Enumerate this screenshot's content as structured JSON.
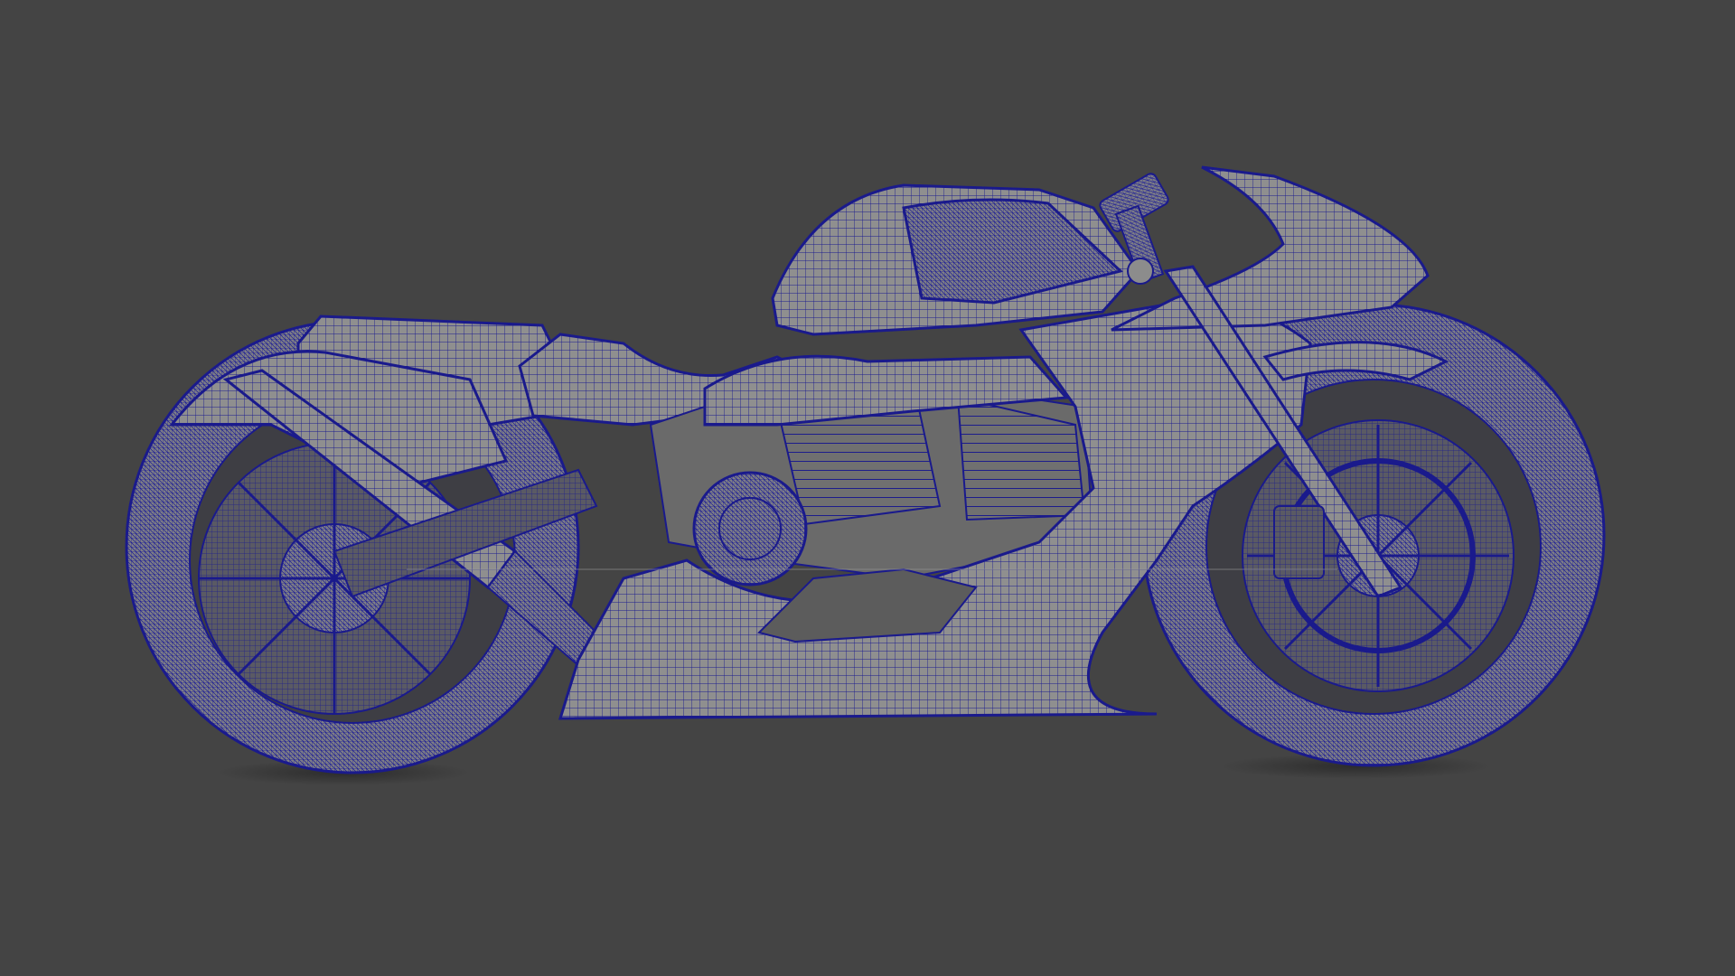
{
  "viewport": {
    "background_color": "#444444",
    "render_mode": "wireframe-on-shaded",
    "wire_color": "#1a1a8c",
    "surface_color": "#8c8c8c"
  },
  "model": {
    "subject": "motorcycle",
    "view": "side",
    "icon": "motorcycle-wireframe-model"
  }
}
